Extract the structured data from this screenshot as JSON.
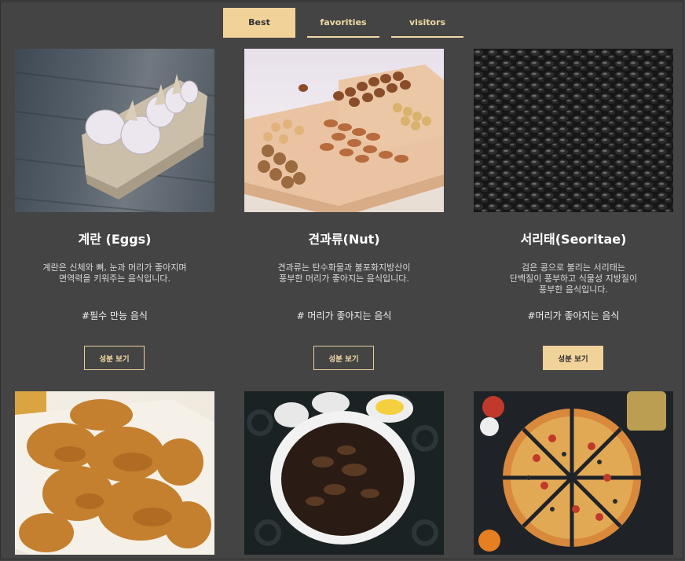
{
  "tabs": [
    {
      "label": "Best",
      "active": true
    },
    {
      "label": "favorities",
      "active": false
    },
    {
      "label": "visitors",
      "active": false
    }
  ],
  "cards": [
    {
      "title": "계란 (Eggs)",
      "description": "계란은 신체와 뼈, 눈과 머리가 좋아지며\n면역력을 키워주는 음식입니다.",
      "tag": "#필수 만능 음식",
      "button": "성분 보기",
      "button_filled": false
    },
    {
      "title": "견과류(Nut)",
      "description": "견과류는 탄수화물과 불포화지방산이\n풍부한 머리가 좋아지는 음식입니다.",
      "tag": "# 머리가 좋아지는 음식",
      "button": "성분 보기",
      "button_filled": false
    },
    {
      "title": "서리태(Seoritae)",
      "description": "검은 콩으로 불리는 서리태는\n단백질이 풍부하고 식물성 지방질이\n풍부한 음식입니다.",
      "tag": "#머리가 좋아지는 음식",
      "button": "성분 보기",
      "button_filled": true
    }
  ],
  "colors": {
    "accent": "#f1d39a",
    "background": "#444444"
  }
}
